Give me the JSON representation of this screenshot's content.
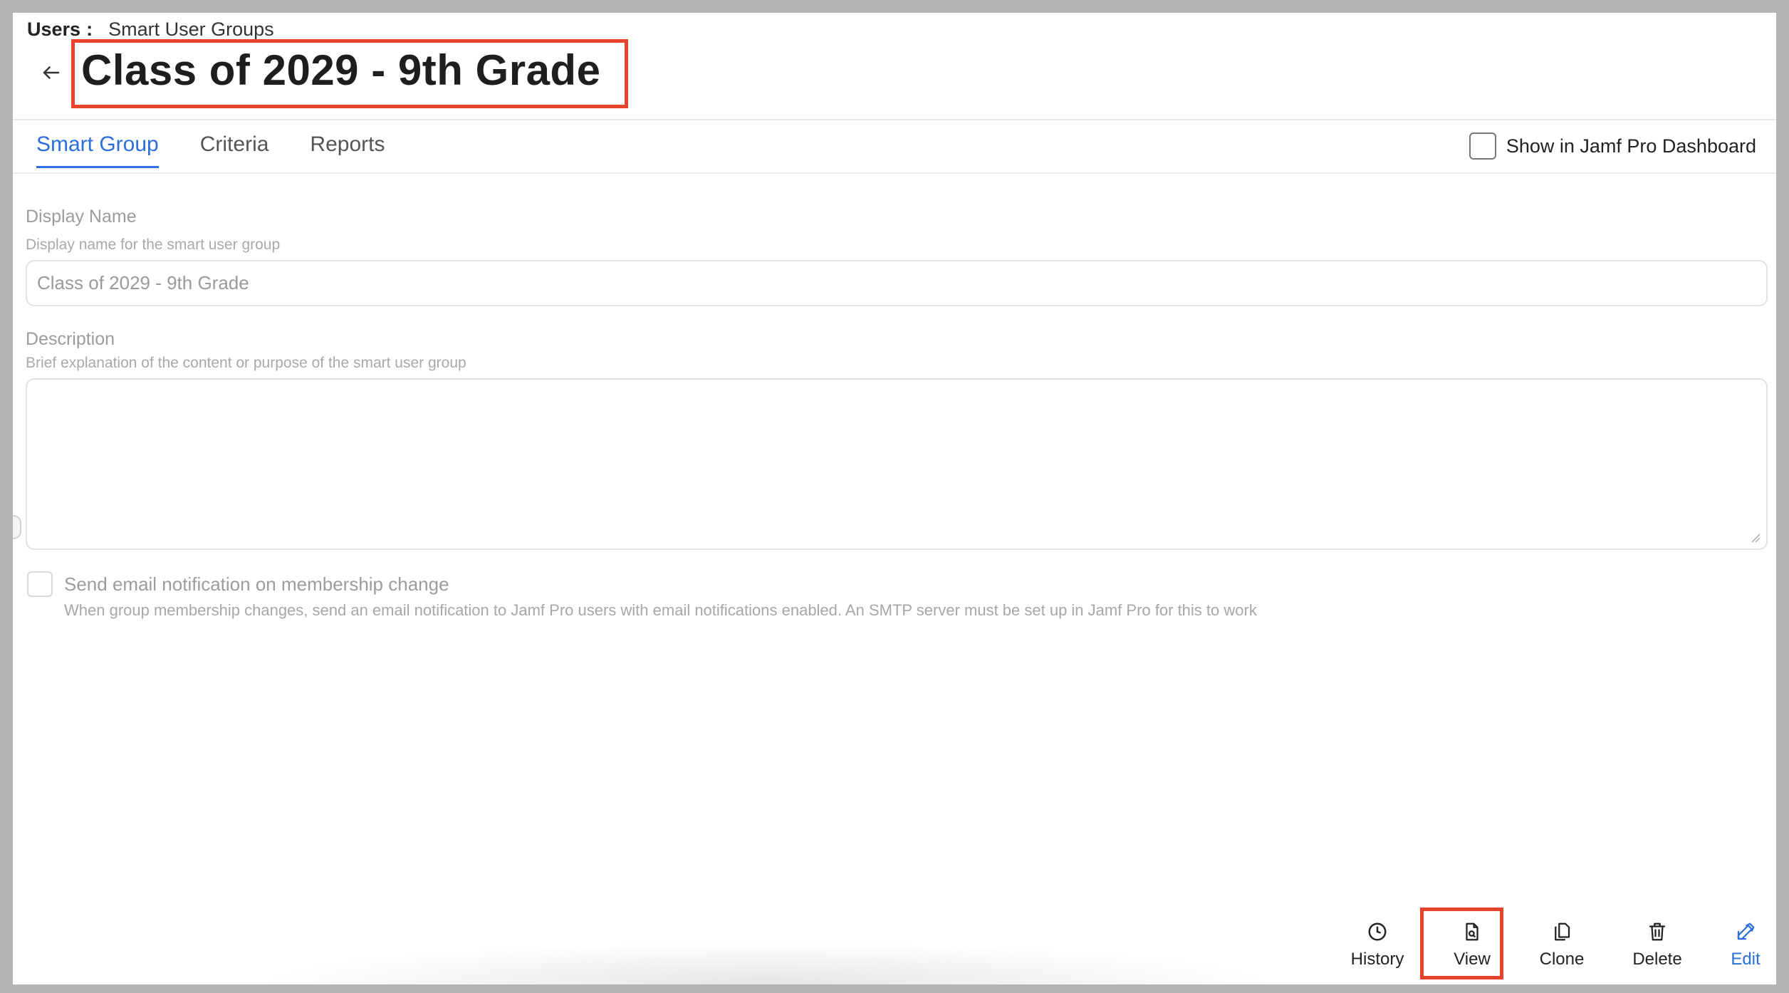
{
  "breadcrumb": {
    "root": "Users",
    "separator": ":",
    "current": "Smart User Groups"
  },
  "header": {
    "title": "Class of 2029 - 9th Grade",
    "back_icon": "arrow-left-icon"
  },
  "tabs": [
    {
      "label": "Smart Group",
      "active": true
    },
    {
      "label": "Criteria",
      "active": false
    },
    {
      "label": "Reports",
      "active": false
    }
  ],
  "dashboard_toggle": {
    "label": "Show in Jamf Pro Dashboard",
    "checked": false
  },
  "form": {
    "display_name": {
      "label": "Display Name",
      "help": "Display name for the smart user group",
      "value": "Class of 2029 - 9th Grade"
    },
    "description": {
      "label": "Description",
      "help": "Brief explanation of the content or purpose of the smart user group",
      "value": ""
    },
    "email_notification": {
      "label": "Send email notification on membership change",
      "help": "When group membership changes, send an email notification to Jamf Pro users with email notifications enabled. An SMTP server must be set up in Jamf Pro for this to work",
      "checked": false
    }
  },
  "actions": [
    {
      "label": "History",
      "icon": "clock-icon"
    },
    {
      "label": "View",
      "icon": "document-view-icon"
    },
    {
      "label": "Clone",
      "icon": "copy-icon"
    },
    {
      "label": "Delete",
      "icon": "trash-icon"
    },
    {
      "label": "Edit",
      "icon": "pencil-icon"
    }
  ],
  "colors": {
    "accent": "#2a6fdb",
    "highlight": "#e8442b"
  }
}
